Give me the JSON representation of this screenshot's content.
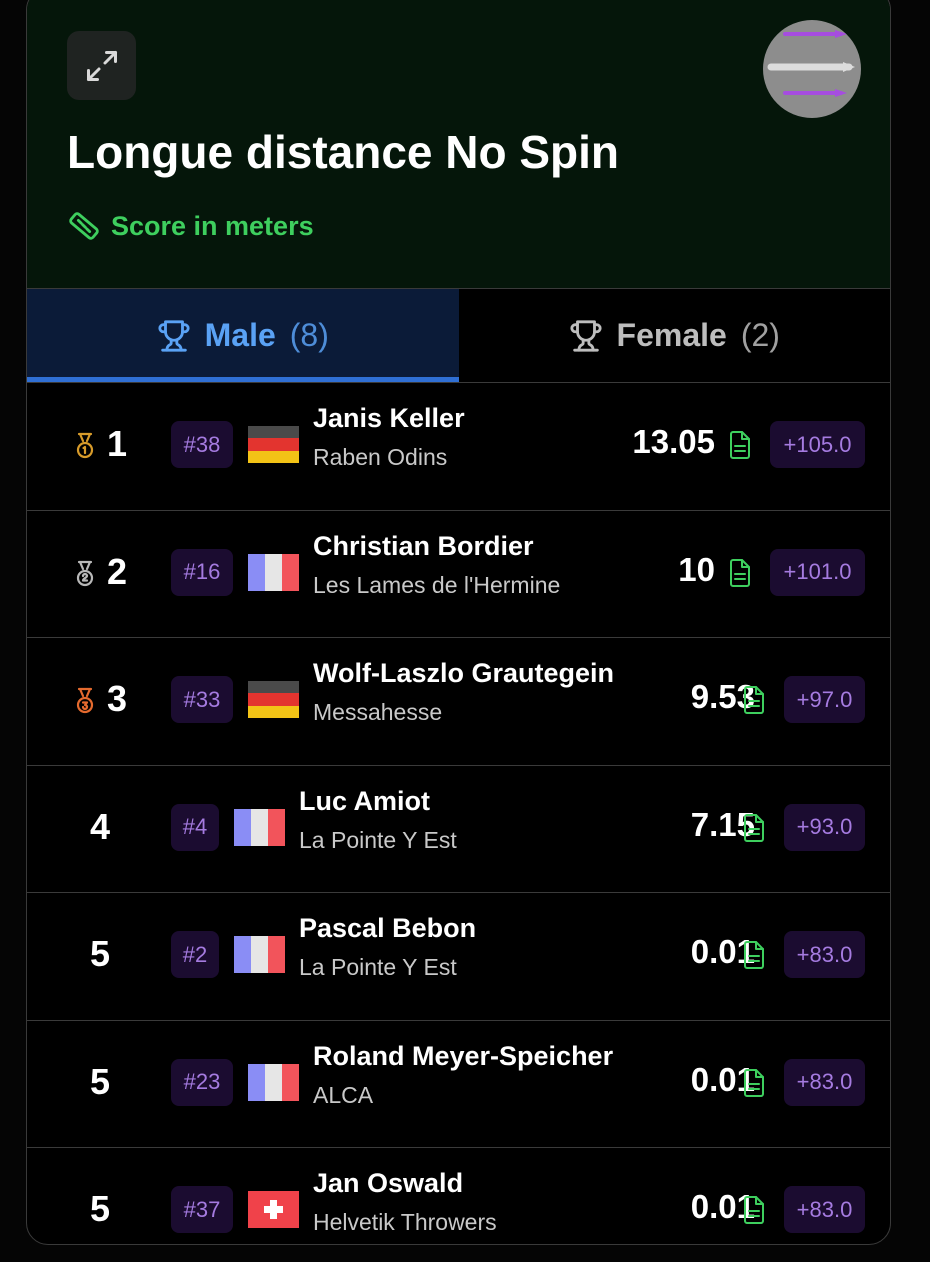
{
  "header": {
    "title": "Longue distance No Spin",
    "subtitle": "Score in meters",
    "expand_icon": "expand-icon",
    "ruler_icon": "ruler-icon",
    "logo": "discipline-logo"
  },
  "tabs": [
    {
      "label": "Male",
      "count": "(8)",
      "icon": "trophy-icon",
      "active": true
    },
    {
      "label": "Female",
      "count": "(2)",
      "icon": "trophy-icon",
      "active": false
    }
  ],
  "colors": {
    "accent_green": "#3ecf5e",
    "accent_blue": "#5aa2f5",
    "badge_purple": "#a57be0",
    "badge_bg": "#1b0c30",
    "gold": "#d79b2a",
    "silver": "#b8b8b8",
    "bronze": "#e56a2e"
  },
  "rows": [
    {
      "rank": "1",
      "medal": "gold",
      "bib": "#38",
      "country": "germany",
      "name": "Janis Keller",
      "club": "Raben Odins",
      "score": "13.05",
      "points": "+105.0"
    },
    {
      "rank": "2",
      "medal": "silver",
      "bib": "#16",
      "country": "france",
      "name": "Christian Bordier",
      "club": "Les Lames de l'Hermine",
      "score": "10",
      "points": "+101.0"
    },
    {
      "rank": "3",
      "medal": "bronze",
      "bib": "#33",
      "country": "germany",
      "name": "Wolf-Laszlo Grautegein",
      "club": "Messahesse",
      "score": "9.53",
      "points": "+97.0"
    },
    {
      "rank": "4",
      "medal": "",
      "bib": "#4",
      "country": "france",
      "name": "Luc Amiot",
      "club": "La Pointe Y Est",
      "score": "7.15",
      "points": "+93.0"
    },
    {
      "rank": "5",
      "medal": "",
      "bib": "#2",
      "country": "france",
      "name": "Pascal Bebon",
      "club": "La Pointe Y Est",
      "score": "0.01",
      "points": "+83.0"
    },
    {
      "rank": "5",
      "medal": "",
      "bib": "#23",
      "country": "france",
      "name": "Roland Meyer-Speicher",
      "club": "ALCA",
      "score": "0.01",
      "points": "+83.0"
    },
    {
      "rank": "5",
      "medal": "",
      "bib": "#37",
      "country": "switzerland",
      "name": "Jan Oswald",
      "club": "Helvetik Throwers",
      "score": "0.01",
      "points": "+83.0"
    }
  ]
}
